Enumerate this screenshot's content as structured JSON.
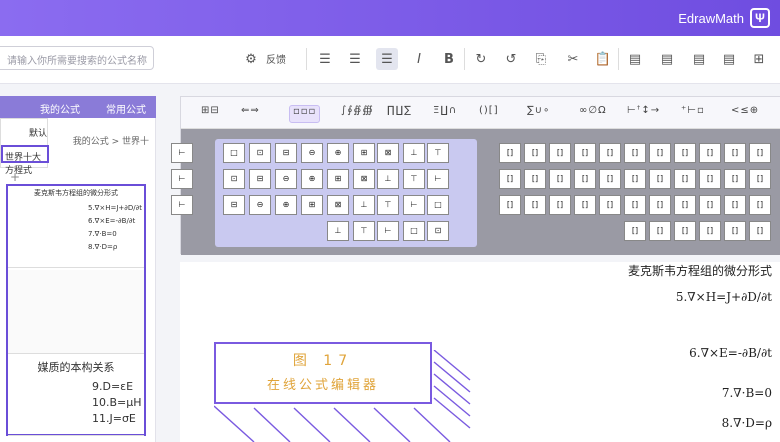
{
  "app": {
    "brand": "EdrawMath",
    "logo_glyph": "Ψ",
    "brand_color": "#7456e6"
  },
  "toolbar": {
    "search_placeholder": "请输入你所需要搜索的公式名称",
    "feedback_label": "反馈",
    "buttons": [
      "align-left",
      "align-center",
      "align-justify",
      "italic",
      "bold",
      "redo",
      "undo",
      "copy",
      "cut",
      "paste",
      "insert-1",
      "insert-2",
      "insert-3",
      "insert-4",
      "add"
    ]
  },
  "left": {
    "tabs": [
      "常用公式",
      "我的公式"
    ],
    "breadcrumb": "我的公式 > 世界十",
    "dropdown": [
      "默认",
      "世界十大方程式"
    ],
    "thumb1": {
      "title": "麦克斯韦方程组的微分形式",
      "lines": [
        "5.∇×H=J+∂D/∂t",
        "6.∇×E=-∂B/∂t",
        "7.∇·B=0",
        "8.∇·D=ρ"
      ]
    },
    "thumb2": {
      "title": "媒质的本构关系",
      "lines": [
        "9.D=εE",
        "10.B=μH",
        "11.J=σE"
      ]
    }
  },
  "editor": {
    "groups": [
      "<≤⊕",
      "⁺⊢▫",
      "⊢ꜛ↕→",
      "∞∅Ω",
      "∑∪∘",
      "∫∮∯",
      "()[]",
      "∏∐∑",
      "Ξ∐∩",
      "∫∮∯∰",
      "←⇒",
      "∏∐∑"
    ],
    "right_cells": [
      "[]",
      "[]",
      "[]",
      "[]",
      "[]",
      "[]",
      "[]",
      "[]",
      "[]",
      "[]",
      "[]"
    ],
    "left_cells": [
      "□",
      "□",
      "□",
      "□",
      "□",
      "□",
      "□",
      "□",
      "□",
      "□"
    ]
  },
  "doc": {
    "title": "麦克斯韦方程组的微分形式",
    "eqs": [
      "5.∇×H=J+∂D/∂t",
      "6.∇×E=-∂B/∂t",
      "7.∇·B=0",
      "8.∇·D=ρ"
    ],
    "caption_line1": "图 17",
    "caption_line2": "在线公式编辑器"
  }
}
